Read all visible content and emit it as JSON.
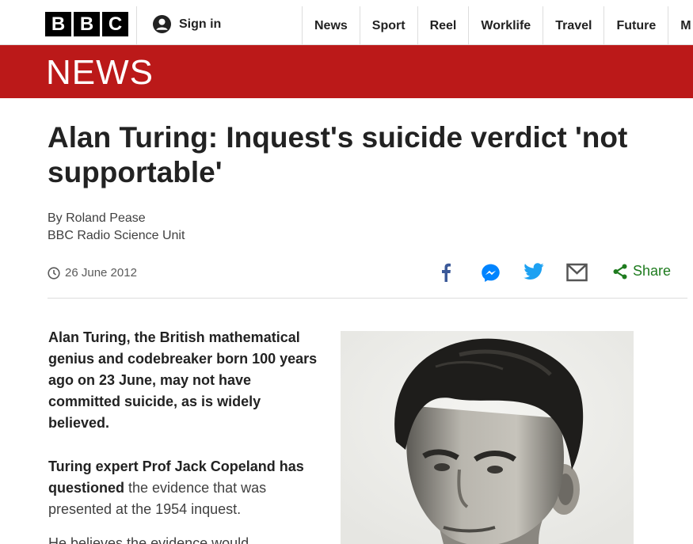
{
  "header": {
    "logo_letters": [
      "B",
      "B",
      "C"
    ],
    "signin_label": "Sign in",
    "nav": [
      "News",
      "Sport",
      "Reel",
      "Worklife",
      "Travel",
      "Future",
      "M"
    ]
  },
  "section": {
    "title": "NEWS"
  },
  "article": {
    "headline": "Alan Turing: Inquest's suicide verdict 'not supportable'",
    "byline_author": "By Roland Pease",
    "byline_unit": "BBC Radio Science Unit",
    "date": "26 June 2012",
    "share_label": "Share",
    "intro": "Alan Turing, the British mathematical genius and codebreaker born 100 years ago on 23 June, may not have committed suicide, as is widely believed.",
    "para2_bold": "Turing expert Prof Jack Copeland has questioned",
    "para2_rest": " the evidence that was presented at the 1954 inquest.",
    "para3": "He believes the evidence would"
  },
  "colors": {
    "brand_red": "#bb1919",
    "facebook": "#3b5998",
    "messenger": "#0084ff",
    "twitter": "#1da1f2",
    "share_green": "#1e7b1e"
  },
  "icons": [
    "user-icon",
    "clock-icon",
    "facebook-icon",
    "messenger-icon",
    "twitter-icon",
    "email-icon",
    "share-icon"
  ]
}
